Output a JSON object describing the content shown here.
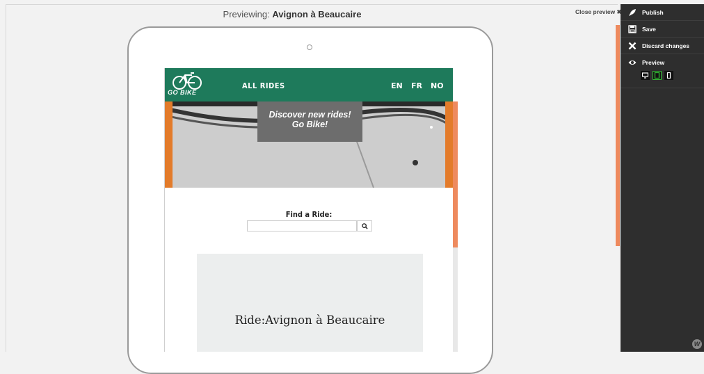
{
  "preview_bar": {
    "prefix": "Previewing: ",
    "page_title": "Avignon à Beaucaire",
    "close_label": "Close preview",
    "close_icon": "close-icon"
  },
  "site": {
    "logo_text": "GO BIKE",
    "nav_all_rides": "ALL RIDES",
    "languages": [
      "EN",
      "FR",
      "NO"
    ],
    "hero_text_line1": "Discover new rides!",
    "hero_text_line2": "Go Bike!",
    "find_label": "Find a Ride:",
    "search_value": "",
    "search_icon": "search-icon",
    "card_title": "Ride:Avignon à Beaucaire"
  },
  "panel": {
    "items": [
      {
        "label": "Publish",
        "icon": "rocket-icon"
      },
      {
        "label": "Save",
        "icon": "floppy-icon"
      },
      {
        "label": "Discard changes",
        "icon": "close-icon"
      },
      {
        "label": "Preview",
        "icon": "eye-icon"
      }
    ],
    "devices": [
      {
        "name": "desktop",
        "active": false
      },
      {
        "name": "tablet",
        "active": true
      },
      {
        "name": "mobile",
        "active": false
      }
    ]
  },
  "colors": {
    "header_green": "#1e7a5b",
    "accent_orange": "#e37b2a",
    "panel_dark": "#2e2e2e",
    "active_device": "#33bb33"
  }
}
